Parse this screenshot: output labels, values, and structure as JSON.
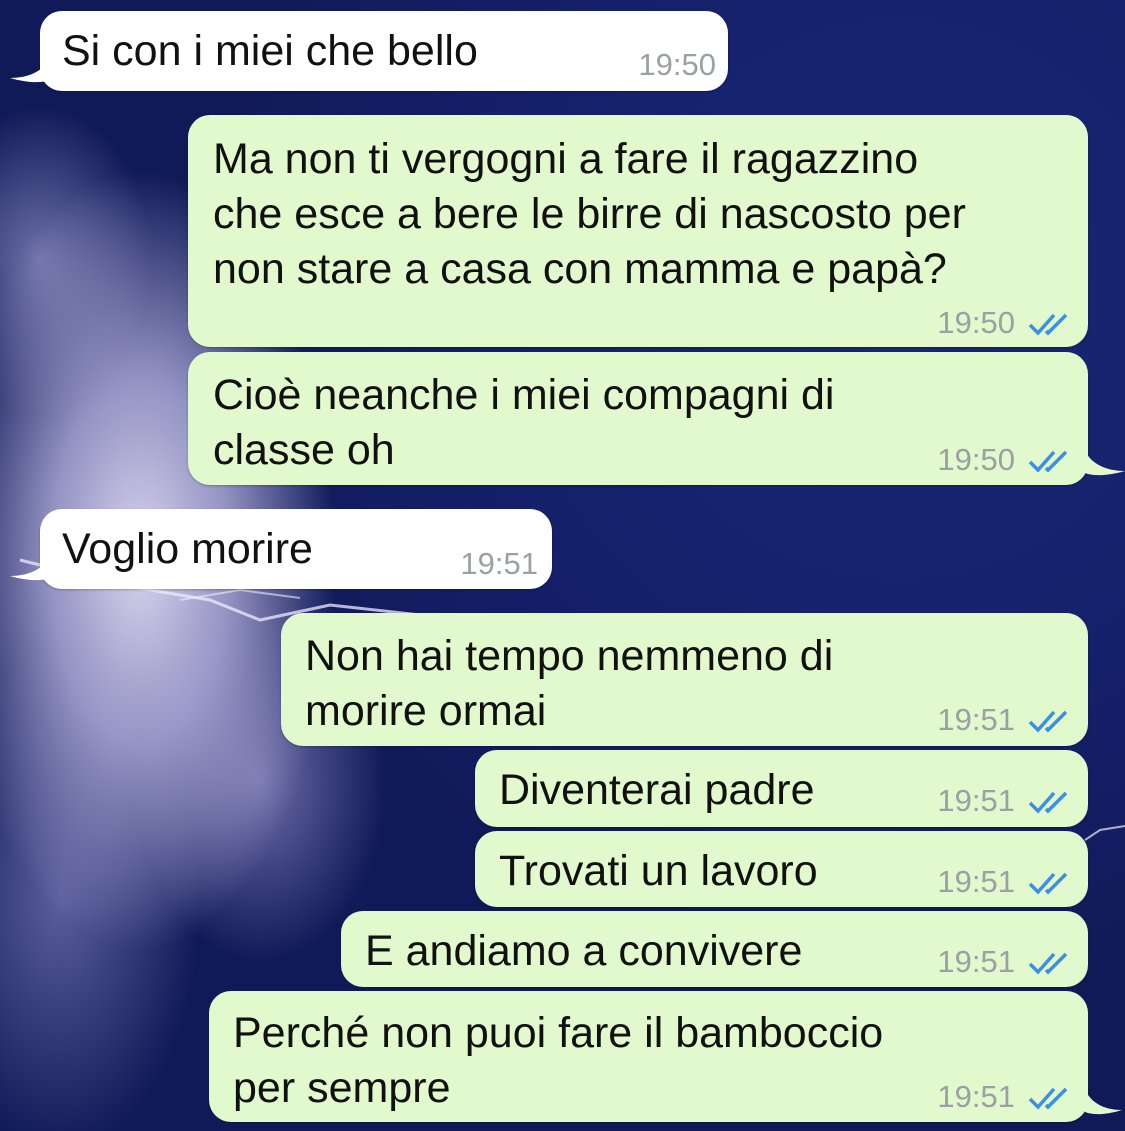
{
  "messages": [
    {
      "direction": "in",
      "text": "Si con i miei che bello",
      "time": "19:50"
    },
    {
      "direction": "out",
      "text": "Ma non ti vergogni a fare il ragazzino\nche esce a bere le birre di nascosto per\nnon stare a casa con mamma e papà?",
      "time": "19:50",
      "read": true
    },
    {
      "direction": "out",
      "text": "Cioè neanche i miei compagni di\nclasse oh",
      "time": "19:50",
      "read": true
    },
    {
      "direction": "in",
      "text": "Voglio morire",
      "time": "19:51"
    },
    {
      "direction": "out",
      "text": "Non hai tempo nemmeno di\nmorire ormai",
      "time": "19:51",
      "read": true
    },
    {
      "direction": "out",
      "text": "Diventerai padre",
      "time": "19:51",
      "read": true
    },
    {
      "direction": "out",
      "text": "Trovati un lavoro",
      "time": "19:51",
      "read": true
    },
    {
      "direction": "out",
      "text": "E andiamo a convivere",
      "time": "19:51",
      "read": true
    },
    {
      "direction": "out",
      "text": "Perché non puoi fare il bamboccio\nper sempre",
      "time": "19:51",
      "read": true
    }
  ],
  "colors": {
    "incoming_bubble": "#ffffff",
    "outgoing_bubble": "#e2f8cd",
    "timestamp": "#9c9fa4",
    "read_check": "#3b8fe6",
    "wallpaper": "#1d2a80"
  },
  "icons": {
    "read_receipt": "double-check-icon",
    "wallpaper": "lightning-storm-wallpaper"
  }
}
